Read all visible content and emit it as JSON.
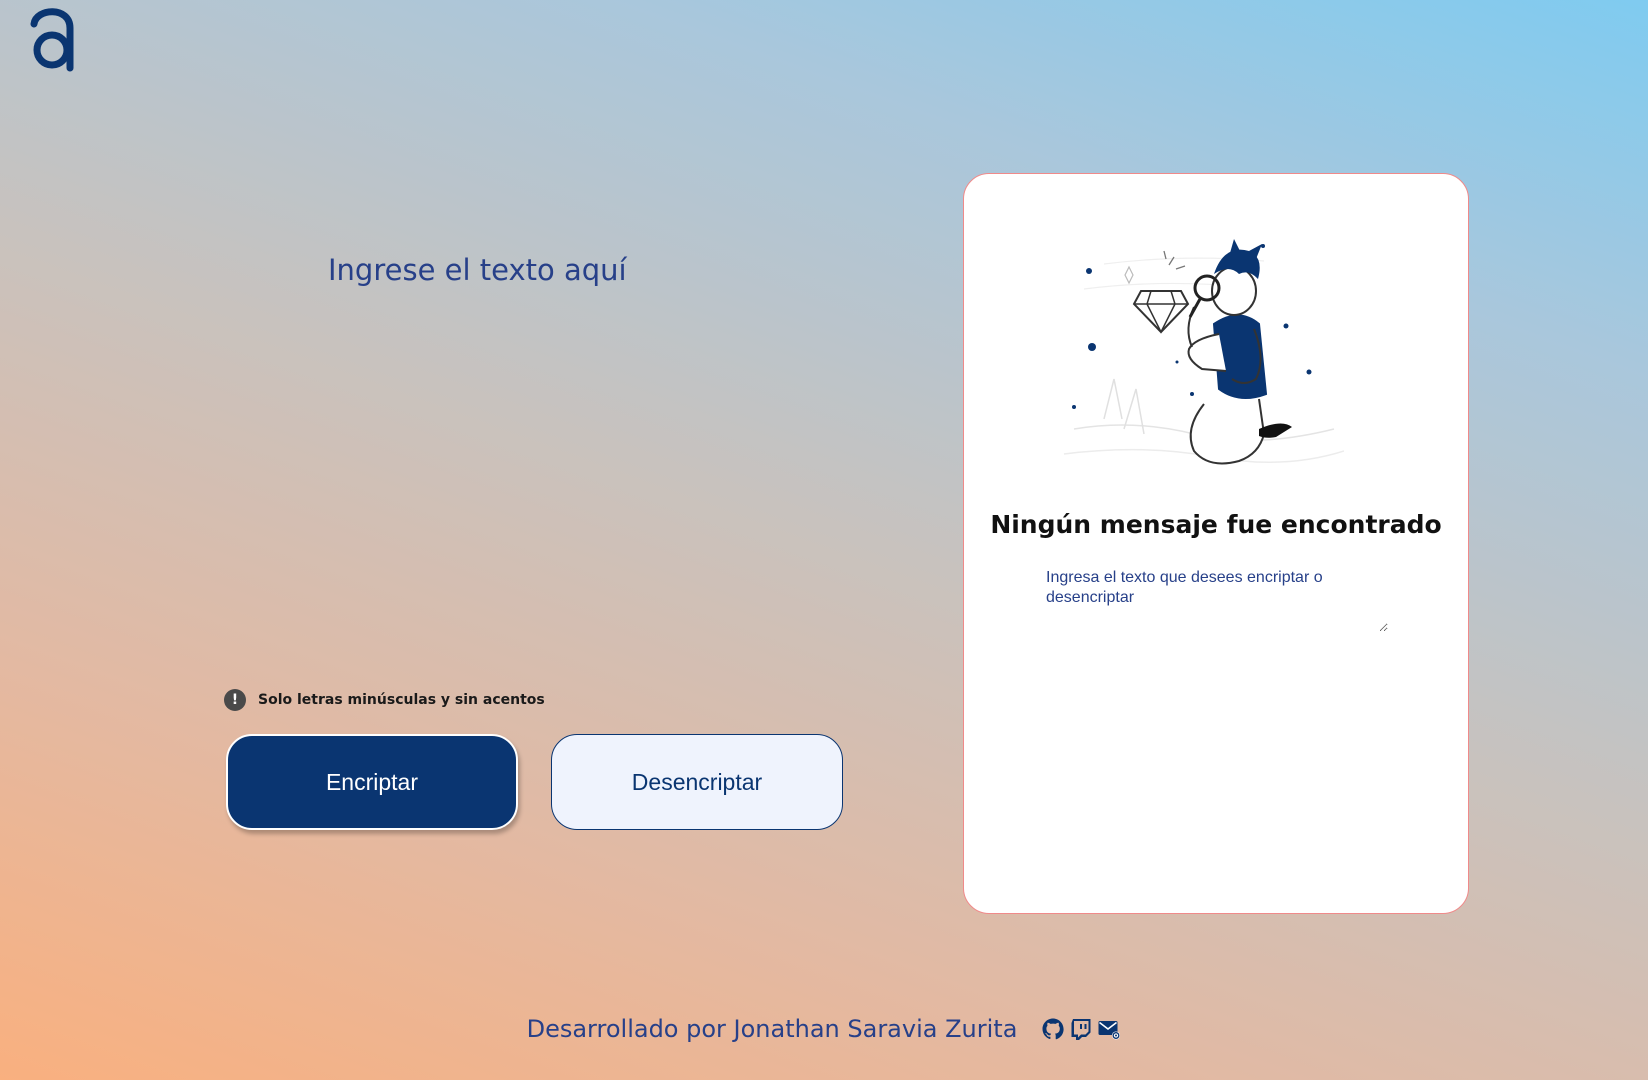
{
  "logo": {
    "icon": "alura-logo-icon",
    "color": "#0a3571"
  },
  "editor": {
    "placeholder": "Ingrese el texto aquí",
    "value": ""
  },
  "hint": {
    "icon": "exclamation-circle-icon",
    "text": "Solo letras minúsculas y sin acentos"
  },
  "buttons": {
    "encrypt_label": "Encriptar",
    "decrypt_label": "Desencriptar"
  },
  "result_panel": {
    "illustration": "person-with-magnifying-glass-illustration",
    "title": "Ningún mensaje fue encontrado",
    "output_placeholder": "Ingresa el texto que desees encriptar o desencriptar",
    "border_color": "#f08a8a"
  },
  "footer": {
    "text": "Desarrollado por Jonathan Saravia Zurita",
    "icons": [
      "github-icon",
      "twitch-icon",
      "email-icon"
    ]
  },
  "colors": {
    "primary": "#0a3571",
    "text": "#274089",
    "button_light": "#eff3fd"
  }
}
